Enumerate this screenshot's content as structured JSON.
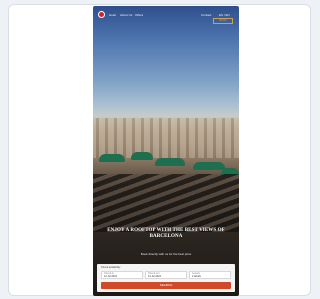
{
  "nav": {
    "items": [
      "Hotel",
      "About Us",
      "Offers"
    ],
    "right_items": [
      "Contact",
      "ES / EN"
    ],
    "book_label": "BOOK"
  },
  "hero": {
    "headline": "ENJOY A ROOFTOP WITH THE BEST VIEWS OF BARCELONA",
    "subline": "Book directly with us for the best price"
  },
  "search": {
    "title": "Check availability",
    "checkin_label": "Check-in",
    "checkin_value": "12 Jul 2024",
    "checkout_label": "Check-out",
    "checkout_value": "14 Jul 2024",
    "guests_label": "Guests",
    "guests_value": "2 Adults",
    "button_label": "SEARCH"
  },
  "colors": {
    "accent": "#d2492a",
    "logo": "#d3222a",
    "umbrella": "#1e6e50"
  }
}
